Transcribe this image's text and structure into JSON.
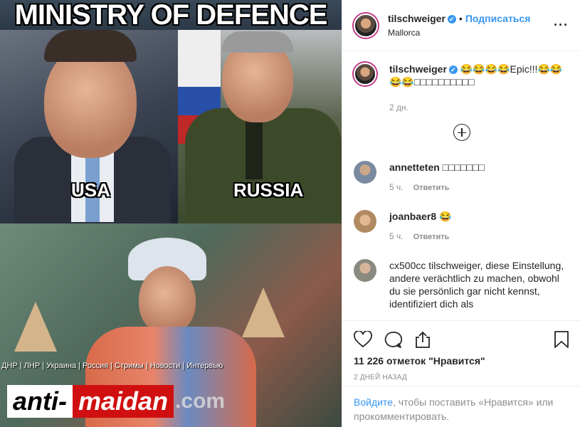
{
  "media": {
    "title": "MINISTRY OF DEFENCE",
    "label_left": "USA",
    "label_right": "RUSSIA",
    "ticker": "ДНР | ЛНР | Украина | Россия | Стримы | Новости | Интервью",
    "watermark_a": "anti-",
    "watermark_b": "maidan",
    "watermark_c": ".com"
  },
  "header": {
    "username": "tilschweiger",
    "verified_glyph": "✔",
    "separator": "•",
    "follow_label": "Подписаться",
    "location": "Mallorca",
    "more_glyph": "···"
  },
  "caption": {
    "username": "tilschweiger",
    "text": "😂😂😂😂Epic!!!😂😂😂😂□□□□□□□□□□",
    "time": "2 дн."
  },
  "comments": [
    {
      "username": "annetteten",
      "text": "□□□□□□□",
      "time": "5 ч.",
      "reply": "Ответить"
    },
    {
      "username": "joanbaer8",
      "text": "😂",
      "time": "5 ч.",
      "reply": "Ответить"
    },
    {
      "username": "cx500cc",
      "text": "tilschweiger, diese Einstellung, andere verächtlich zu machen, obwohl du sie persönlich gar nicht kennst, identifiziert dich als"
    }
  ],
  "actions": {
    "likes": "11 226 отметок \"Нравится\"",
    "date": "2 ДНЕЙ НАЗАД"
  },
  "login": {
    "link": "Войдите",
    "rest": ", чтобы поставить «Нравится» или прокомментировать."
  },
  "colors": {
    "accent": "#3897f0",
    "text": "#262626",
    "muted": "#8e8e8e"
  },
  "icons": [
    "heart-icon",
    "comment-icon",
    "share-icon",
    "bookmark-icon",
    "add-comments-icon"
  ]
}
